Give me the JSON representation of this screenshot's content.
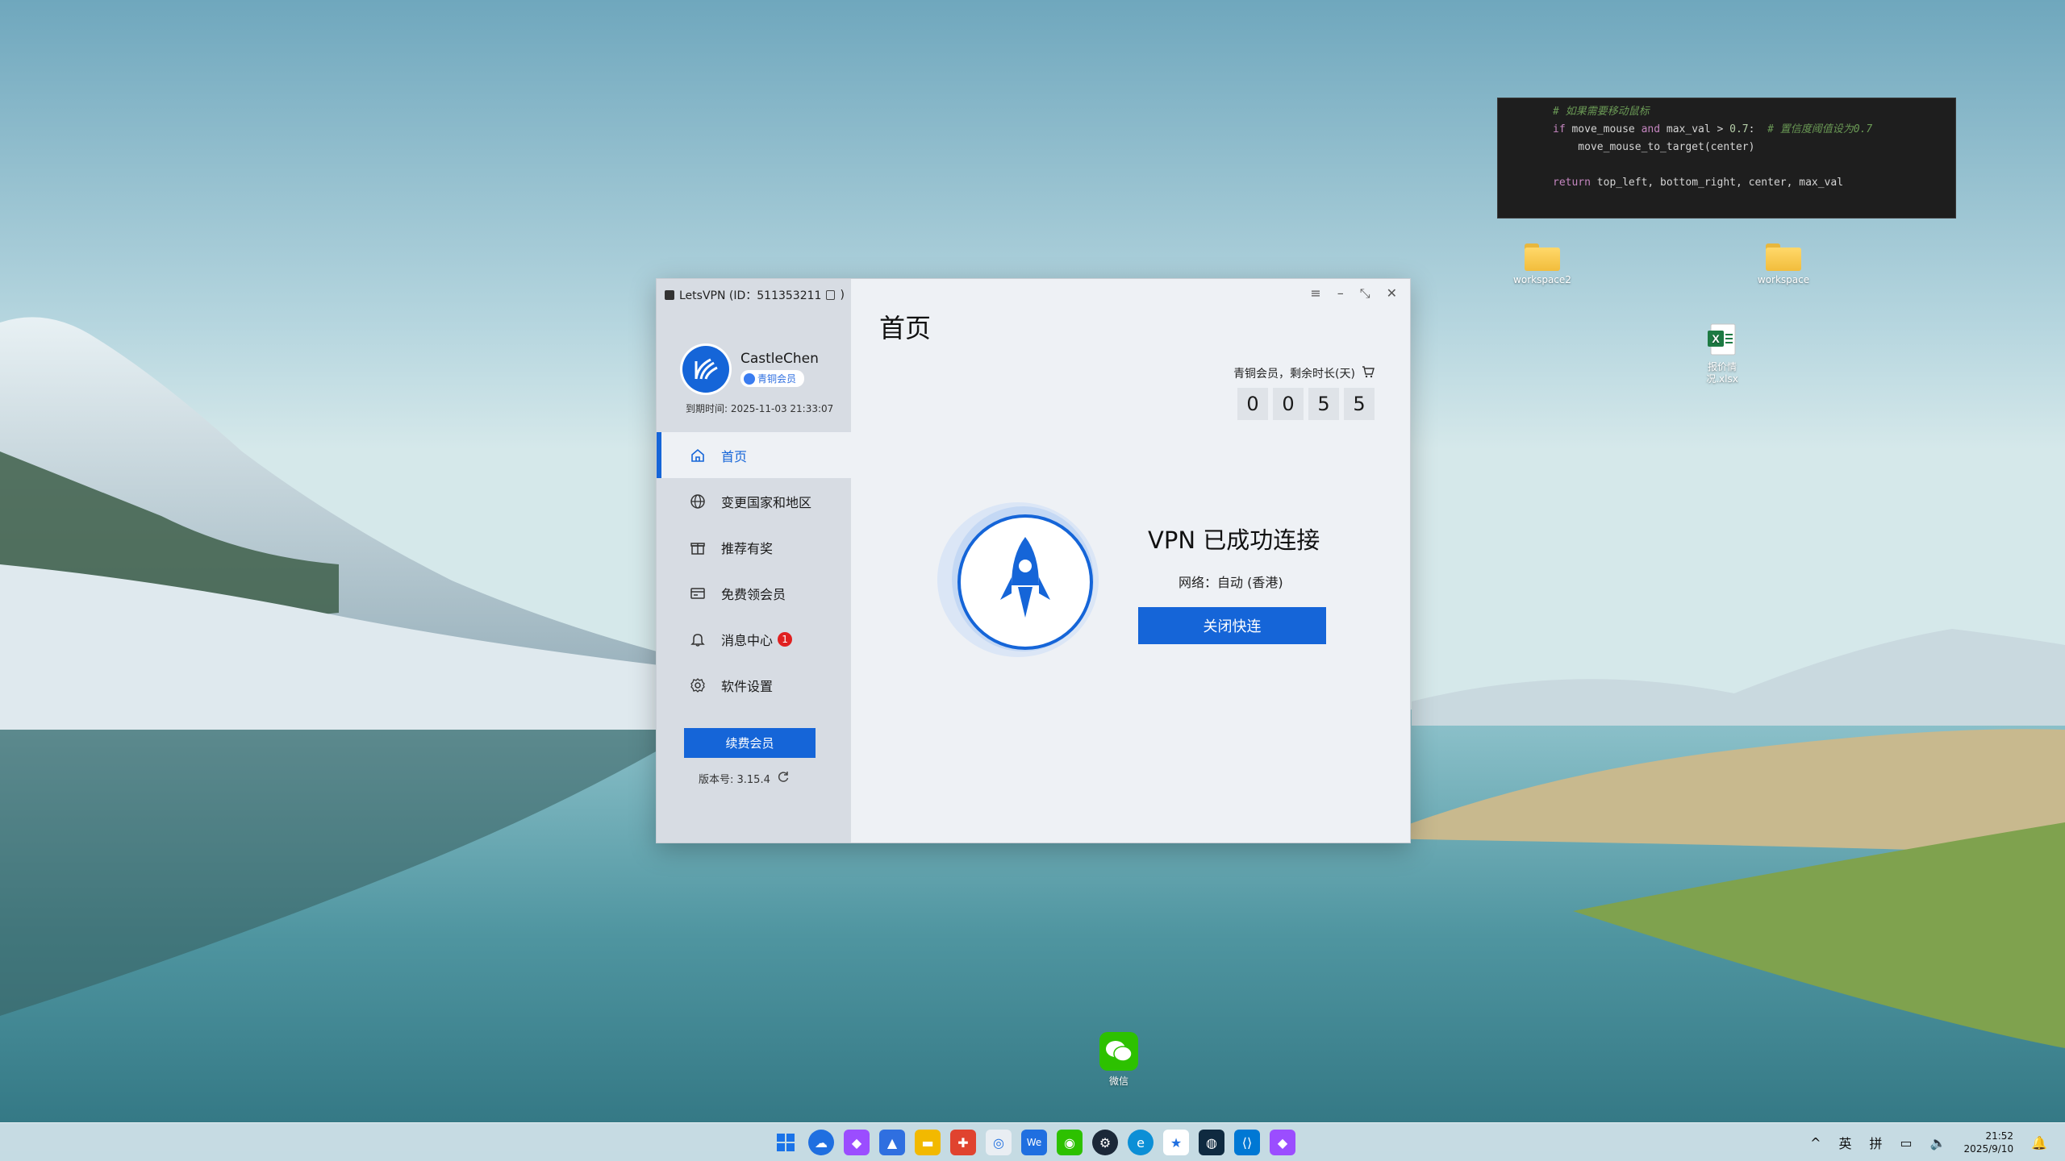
{
  "code": {
    "lines": [
      {
        "comment": "# 如果需要移动鼠标"
      },
      {
        "kw": "if",
        "a": " move_mouse ",
        "kw2": "and",
        "b": " max_val > ",
        "num": "0.7",
        "c": ":  ",
        "comment": "# 置信度阈值设为0.7"
      },
      {
        "a": "    move_mouse_to_target(center)"
      },
      {
        "a": ""
      },
      {
        "kw": "return",
        "a": " top_left, bottom_right, center, max_val"
      }
    ]
  },
  "desktop": {
    "icons": [
      {
        "label": "workspace2"
      },
      {
        "label": "workspace"
      },
      {
        "label": "报价情况.xlsx"
      },
      {
        "label": "微信"
      }
    ]
  },
  "app": {
    "title": "LetsVPN (ID：511353211",
    "title_suffix": ")",
    "user": {
      "name": "CastleChen",
      "tier": "青铜会员",
      "expire": "到期时间: 2025-11-03 21:33:07"
    },
    "nav": [
      {
        "label": "首页",
        "icon": "home-icon"
      },
      {
        "label": "变更国家和地区",
        "icon": "globe-icon"
      },
      {
        "label": "推荐有奖",
        "icon": "gift-icon"
      },
      {
        "label": "免费领会员",
        "icon": "card-icon"
      },
      {
        "label": "消息中心",
        "icon": "bell-icon",
        "badge": "1"
      },
      {
        "label": "软件设置",
        "icon": "gear-icon"
      }
    ],
    "renew_button": "续费会员",
    "version": "版本号:  3.15.4",
    "page_title": "首页",
    "remaining_label": "青铜会员，剩余时长(天)",
    "remaining_digits": [
      "0",
      "0",
      "5",
      "5"
    ],
    "status": "VPN 已成功连接",
    "network": "网络：自动 (香港)",
    "disconnect_button": "关闭快连"
  },
  "taskbar": {
    "tray": {
      "ime1": "英",
      "ime2": "拼",
      "time": "21:52",
      "date": "2025/9/10"
    }
  },
  "colors": {
    "accent": "#1565d8",
    "sidebar": "#d7dce3",
    "content": "#eef1f5"
  }
}
